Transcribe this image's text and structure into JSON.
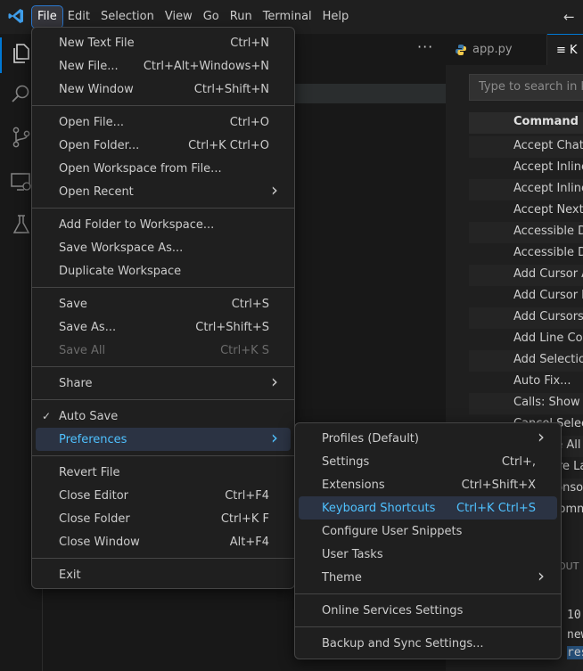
{
  "menubar": {
    "items": [
      "File",
      "Edit",
      "Selection",
      "View",
      "Go",
      "Run",
      "Terminal",
      "Help"
    ],
    "active": "File"
  },
  "tabs": [
    {
      "label": "app.py",
      "icon": "python-file-icon"
    },
    {
      "label": "≡ K",
      "icon": "keyboard-shortcuts-icon"
    }
  ],
  "keybindings": {
    "search_placeholder": "Type to search in keybindings",
    "column_header": "Command",
    "rows": [
      "Accept Chat Inline",
      "Accept Inline Completion",
      "Accept Inline Edit",
      "Accept Next Word",
      "Accessible Diff Viewer",
      "Accessible Diff Viewer",
      "Add Cursor Above",
      "Add Cursor Below",
      "Add Cursors to Line Ends",
      "Add Line Comment",
      "Add Selection to Next",
      "Auto Fix...",
      "Calls: Show Call Hierarchy",
      "Cancel Selection",
      "Collapse All Outline",
      "Configure Language",
      "Clear Console",
      "Insert Comment"
    ]
  },
  "terminal": {
    "label": "OUT",
    "line1": "10",
    "line2": "new",
    "line3": "res"
  },
  "file_menu": {
    "groups": [
      [
        {
          "label": "New Text File",
          "shortcut": "Ctrl+N"
        },
        {
          "label": "New File...",
          "shortcut": "Ctrl+Alt+Windows+N"
        },
        {
          "label": "New Window",
          "shortcut": "Ctrl+Shift+N"
        }
      ],
      [
        {
          "label": "Open File...",
          "shortcut": "Ctrl+O"
        },
        {
          "label": "Open Folder...",
          "shortcut": "Ctrl+K Ctrl+O"
        },
        {
          "label": "Open Workspace from File...",
          "shortcut": ""
        },
        {
          "label": "Open Recent",
          "shortcut": "",
          "submenu": true
        }
      ],
      [
        {
          "label": "Add Folder to Workspace...",
          "shortcut": ""
        },
        {
          "label": "Save Workspace As...",
          "shortcut": ""
        },
        {
          "label": "Duplicate Workspace",
          "shortcut": ""
        }
      ],
      [
        {
          "label": "Save",
          "shortcut": "Ctrl+S"
        },
        {
          "label": "Save As...",
          "shortcut": "Ctrl+Shift+S"
        },
        {
          "label": "Save All",
          "shortcut": "Ctrl+K S",
          "disabled": true
        }
      ],
      [
        {
          "label": "Share",
          "shortcut": "",
          "submenu": true
        }
      ],
      [
        {
          "label": "Auto Save",
          "shortcut": "",
          "checked": true
        },
        {
          "label": "Preferences",
          "shortcut": "",
          "submenu": true,
          "selected": true
        }
      ],
      [
        {
          "label": "Revert File",
          "shortcut": ""
        },
        {
          "label": "Close Editor",
          "shortcut": "Ctrl+F4"
        },
        {
          "label": "Close Folder",
          "shortcut": "Ctrl+K F"
        },
        {
          "label": "Close Window",
          "shortcut": "Alt+F4"
        }
      ],
      [
        {
          "label": "Exit",
          "shortcut": ""
        }
      ]
    ]
  },
  "preferences_menu": {
    "groups": [
      [
        {
          "label": "Profiles (Default)",
          "shortcut": "",
          "submenu": true
        },
        {
          "label": "Settings",
          "shortcut": "Ctrl+,"
        },
        {
          "label": "Extensions",
          "shortcut": "Ctrl+Shift+X"
        },
        {
          "label": "Keyboard Shortcuts",
          "shortcut": "Ctrl+K Ctrl+S",
          "selected": true
        },
        {
          "label": "Configure User Snippets",
          "shortcut": ""
        },
        {
          "label": "User Tasks",
          "shortcut": ""
        },
        {
          "label": "Theme",
          "shortcut": "",
          "submenu": true
        }
      ],
      [
        {
          "label": "Online Services Settings",
          "shortcut": ""
        }
      ],
      [
        {
          "label": "Backup and Sync Settings...",
          "shortcut": ""
        }
      ]
    ]
  },
  "colors": {
    "accent": "#0078d4",
    "menu_highlight": "#4fc1ff"
  }
}
